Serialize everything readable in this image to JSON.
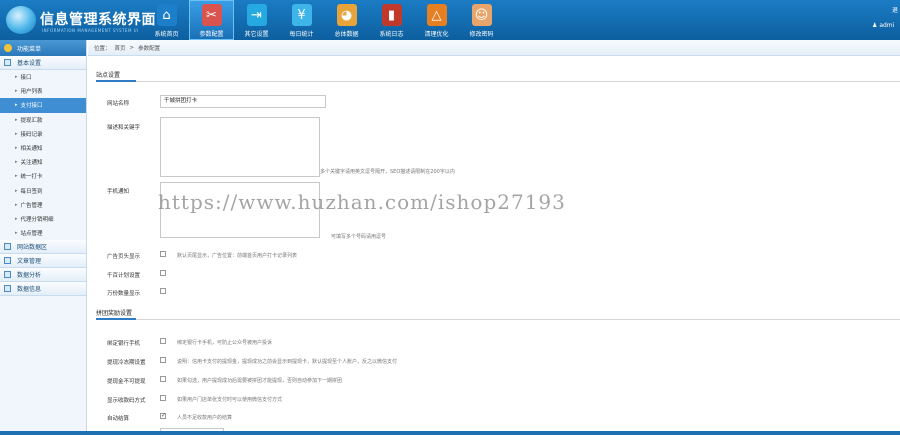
{
  "header": {
    "title": "信息管理系统界面",
    "subtitle": "INFORMATION MANAGEMENT SYSTEM UI",
    "right_top": "退",
    "user": "admi",
    "nav": [
      {
        "label": "系统首页",
        "icon": "home-icon",
        "glyph": "⌂",
        "bg": "#1d7fc9"
      },
      {
        "label": "参数配置",
        "icon": "tools-icon",
        "glyph": "✂",
        "bg": "#d9534f",
        "active": true
      },
      {
        "label": "其它设置",
        "icon": "exit-icon",
        "glyph": "⇥",
        "bg": "#26a9e0"
      },
      {
        "label": "每日统计",
        "icon": "coin-icon",
        "glyph": "¥",
        "bg": "#3db5e8"
      },
      {
        "label": "总体数据",
        "icon": "pie-chart-icon",
        "glyph": "◕",
        "bg": "#e8a43a"
      },
      {
        "label": "系统日志",
        "icon": "book-icon",
        "glyph": "▮",
        "bg": "#c0392b"
      },
      {
        "label": "清理优化",
        "icon": "triangle-icon",
        "glyph": "△",
        "bg": "#e67e22"
      },
      {
        "label": "修改密码",
        "icon": "user-icon",
        "glyph": "☺",
        "bg": "#e8a46a"
      }
    ]
  },
  "sidebar": {
    "quick": "功能菜单",
    "sections": [
      {
        "label": "基本设置",
        "items": [
          "接口",
          "用户列表",
          "支付接口",
          "提现汇款",
          "接码记录",
          "相关通知",
          "关注通知",
          "统一打卡",
          "每日签到",
          "广告管理",
          "代理分销明细",
          "站点管理"
        ]
      },
      {
        "label": "网站数据区"
      },
      {
        "label": "文章管理"
      },
      {
        "label": "数据分析"
      },
      {
        "label": "数据信息"
      }
    ],
    "active_item": 2
  },
  "breadcrumb": [
    "位置：",
    "首页",
    ">",
    "参数配置"
  ],
  "form": {
    "section1": "站点设置",
    "site_name_label": "网站名称",
    "site_name_value": "千城拼团打卡",
    "desc_label": "描述和关键字",
    "desc_hint": "多个关键字请用英文逗号隔开，SEO描述请限制在200字以内",
    "mobile_label": "手机通知",
    "mobile_hint": "可填写多个号码请用逗号",
    "ad_label": "广告页头显示",
    "ad_hint": "默认页尾显示，广告位置：前端首页用户打卡记录列表",
    "open_label": "千百计划设置",
    "stop_label": "万份数量显示",
    "section2": "拼团奖励设置",
    "rows": [
      {
        "label": "绑定银行手机",
        "hint": "绑定银行卡手机，可防止公众号被用户投诉"
      },
      {
        "label": "提现冷冻期设置",
        "hint": "说明：信用卡支付的提现金，提现成功之前会显示到提现卡，默认提现至个人账户，反之以微信支付"
      },
      {
        "label": "提现金不可提现",
        "hint": "如果勾选，用户提现成功后需要被拼团才能提现，否则自动参加下一期拼团"
      },
      {
        "label": "显示收款码方式",
        "hint": "如果用户门店单张支付时可以使用微信支付方式"
      },
      {
        "label": "自动结算",
        "hint": "人员不足收款用户的结算",
        "checked": true
      },
      {
        "label": "一一一一",
        "hint": ""
      }
    ]
  },
  "watermark": "https://www.huzhan.com/ishop27193"
}
